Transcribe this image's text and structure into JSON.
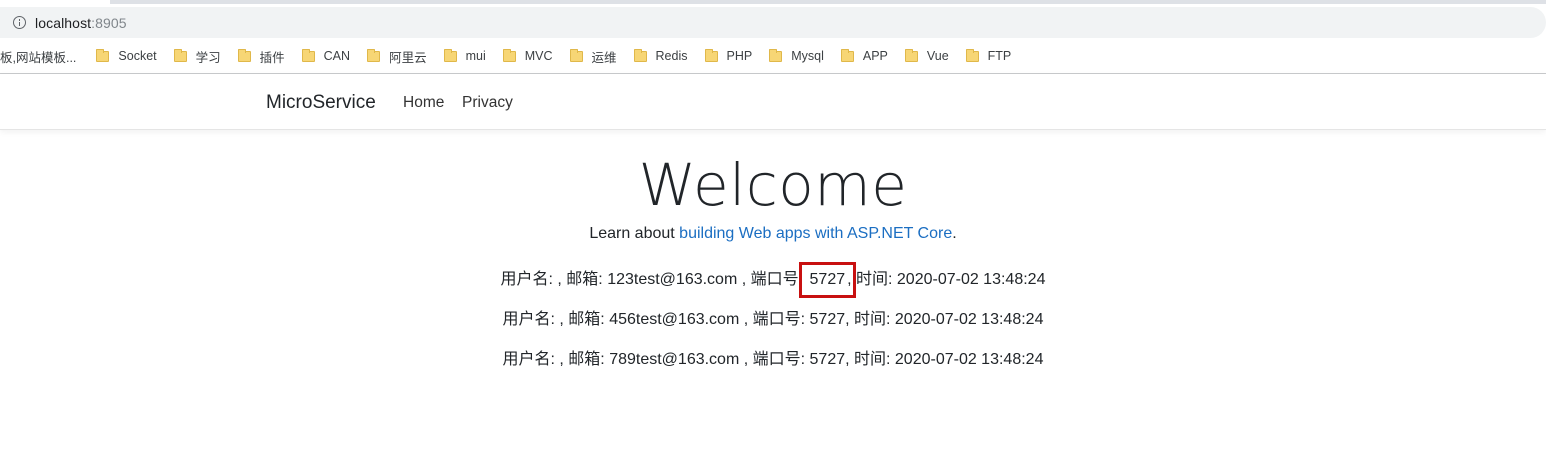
{
  "browser": {
    "url_host": "localhost",
    "url_port": ":8905",
    "bookmarks": [
      {
        "label": "板,网站模板..."
      },
      {
        "label": "Socket"
      },
      {
        "label": "学习"
      },
      {
        "label": "插件"
      },
      {
        "label": "CAN"
      },
      {
        "label": "阿里云"
      },
      {
        "label": "mui"
      },
      {
        "label": "MVC"
      },
      {
        "label": "运维"
      },
      {
        "label": "Redis"
      },
      {
        "label": "PHP"
      },
      {
        "label": "Mysql"
      },
      {
        "label": "APP"
      },
      {
        "label": "Vue"
      },
      {
        "label": "FTP"
      }
    ]
  },
  "navbar": {
    "brand": "MicroService",
    "links": [
      "Home",
      "Privacy"
    ]
  },
  "main": {
    "title": "Welcome",
    "learn_prefix": "Learn about ",
    "learn_link": "building Web apps with ASP.NET Core",
    "learn_suffix": ".",
    "rows": [
      {
        "prefix": "用户名: , 邮箱: 123test@163.com , 端口号: ",
        "port": "5727",
        "suffix": ", 时间: 2020-07-02 13:48:24"
      },
      {
        "prefix": "用户名: , 邮箱: 456test@163.com , 端口号: ",
        "port": "5727",
        "suffix": ", 时间: 2020-07-02 13:48:24"
      },
      {
        "prefix": "用户名: , 邮箱: 789test@163.com , 端口号: ",
        "port": "5727",
        "suffix": ", 时间: 2020-07-02 13:48:24"
      }
    ]
  },
  "colors": {
    "link": "#1b6ec2",
    "highlight_box": "#c81010",
    "folder": "#f7d675"
  }
}
